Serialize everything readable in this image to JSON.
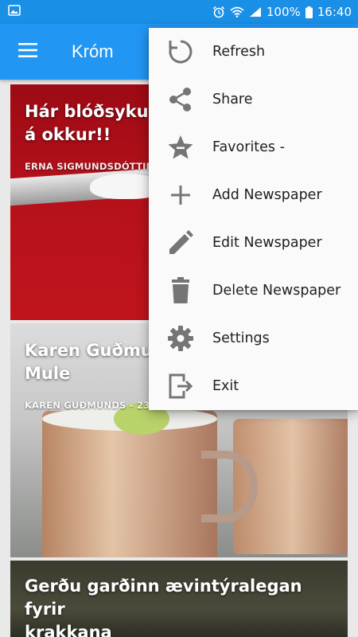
{
  "status_bar": {
    "battery": "100%",
    "time": "16:40",
    "icons": [
      "image-icon",
      "alarm-icon",
      "wifi-icon",
      "signal-icon",
      "battery-icon"
    ]
  },
  "app_bar": {
    "title": "Króm",
    "menu_icon": "hamburger-menu-icon",
    "background": "#2196f3"
  },
  "feed": {
    "articles": [
      {
        "title_visible": "Hár blóðsykur h… á okkur!!",
        "title_line1": "Hár blóðsykur h",
        "title_line2": "á okkur!!",
        "meta": "ERNA SIGMUNDSDÓTTIR  -"
      },
      {
        "title_line1": "Karen Guðmun",
        "title_line2": "Mule",
        "meta": "KAREN GUÐMUNDS  -  23 K"
      },
      {
        "title_line1": "Gerðu garðinn ævintýralegan fyrir",
        "title_line2": "krakkana",
        "meta": ""
      }
    ]
  },
  "overflow_menu": {
    "items": [
      {
        "label": "Refresh",
        "icon": "refresh-icon"
      },
      {
        "label": "Share",
        "icon": "share-icon"
      },
      {
        "label": "Favorites -",
        "icon": "favorites-star-icon"
      },
      {
        "label": "Add Newspaper",
        "icon": "add-icon"
      },
      {
        "label": "Edit Newspaper",
        "icon": "edit-pencil-icon"
      },
      {
        "label": "Delete Newspaper",
        "icon": "delete-trash-icon"
      },
      {
        "label": "Settings",
        "icon": "settings-gear-icon"
      },
      {
        "label": "Exit",
        "icon": "exit-icon"
      }
    ]
  }
}
